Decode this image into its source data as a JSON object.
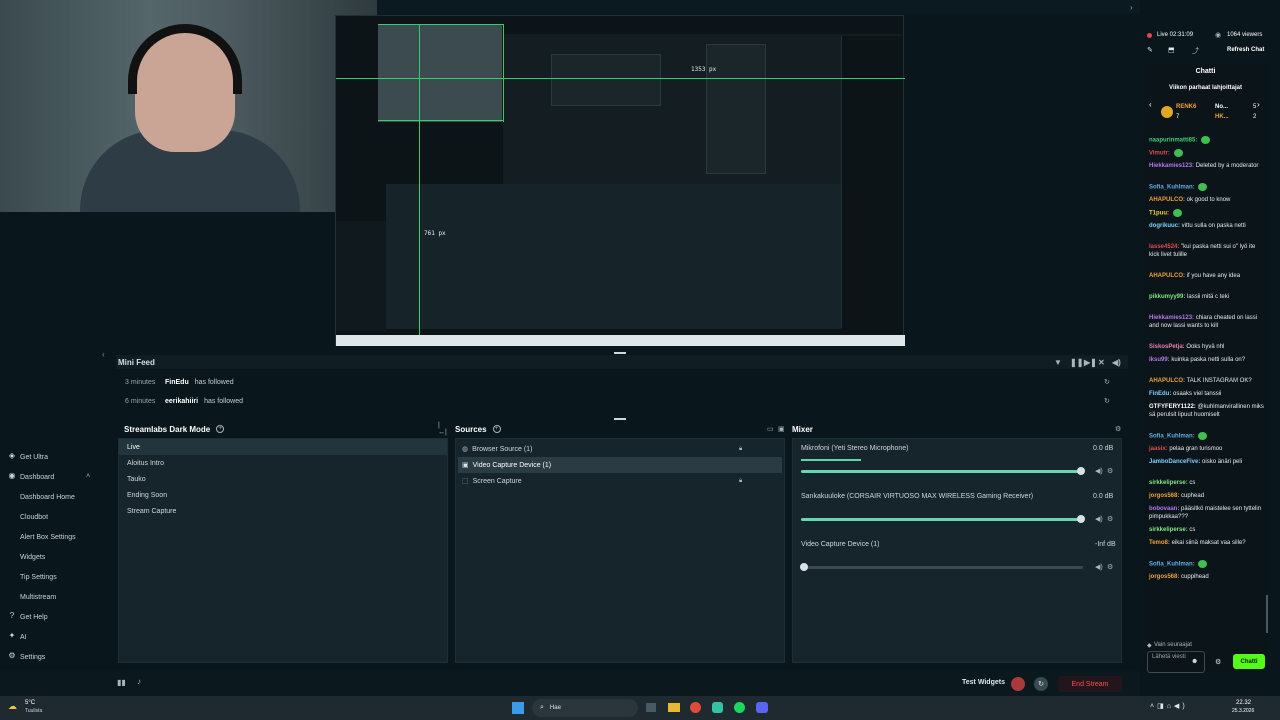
{
  "preview": {
    "measure_w": "1353 px",
    "measure_h": "761 px"
  },
  "minifeed": {
    "title": "Mini Feed",
    "rows": [
      {
        "time": "3 minutes",
        "user": "FinEdu",
        "action": "has followed"
      },
      {
        "time": "6 minutes",
        "user": "eerikahiiri",
        "action": "has followed"
      }
    ]
  },
  "scenes": {
    "title": "Streamlabs Dark Mode",
    "items": [
      "Live",
      "Aloitus Intro",
      "Tauko",
      "Ending Soon",
      "Stream Capture"
    ]
  },
  "sources": {
    "title": "Sources",
    "items": [
      "Browser Source (1)",
      "Video Capture Device (1)",
      "Screen Capture"
    ]
  },
  "mixer": {
    "title": "Mixer",
    "channels": [
      {
        "name": "Mikrofoni (Yeti Stereo Microphone)",
        "db": "0.0 dB",
        "level": 1.0
      },
      {
        "name": "Sankakuuloke (CORSAIR VIRTUOSO MAX WIRELESS Gaming Receiver)",
        "db": "0.0 dB",
        "level": 1.0
      },
      {
        "name": "Video Capture Device (1)",
        "db": "-Inf dB",
        "level": 0.0
      }
    ]
  },
  "sidebar": {
    "get_ultra": "Get Ultra",
    "dashboard": "Dashboard",
    "dashboard_items": [
      "Dashboard Home",
      "Cloudbot",
      "Alert Box Settings",
      "Widgets",
      "Tip Settings",
      "Multistream"
    ],
    "get_help": "Get Help",
    "ai": "AI",
    "settings": "Settings",
    "user": "kuhlmanvirallinen"
  },
  "stream": {
    "live_time": "Live 02:31:09",
    "viewers": "1064 viewers",
    "refresh": "Refresh Chat"
  },
  "chat": {
    "title": "Chatti",
    "top_gifters": "Viikon parhaat lahjoittajat",
    "gifters": [
      "RENK6",
      "No...",
      "HK..."
    ],
    "gifter_counts": [
      "7",
      "5",
      "2"
    ],
    "messages": [
      {
        "name": "naapurinmatti85:",
        "text": "",
        "color": "#3fd07a"
      },
      {
        "name": "Vimutr:",
        "text": "",
        "color": "#e04b4b"
      },
      {
        "name": "Hiekkamies123:",
        "text": "Deleted by a moderator",
        "color": "#b777e8"
      },
      {
        "name": "Sofia_Kuhlman:",
        "text": "",
        "color": "#5fb0e8"
      },
      {
        "name": "AHAPULCO:",
        "text": "ok good to know",
        "color": "#f0a23a"
      },
      {
        "name": "T1puu:",
        "text": "",
        "color": "#f0d23a"
      },
      {
        "name": "dogrikuuc:",
        "text": "vittu sulla on paska netti",
        "color": "#7fcfff"
      },
      {
        "name": "lasse4524:",
        "text": "\"kui paska netti sui o\" lyö ite kick livet tulille",
        "color": "#e04b4b"
      },
      {
        "name": "AHAPULCO:",
        "text": "if you have any idea",
        "color": "#f0a23a"
      },
      {
        "name": "pikkumyy99:",
        "text": "lassii mitä c teki",
        "color": "#7fe87f"
      },
      {
        "name": "Hiekkamies123:",
        "text": "chiara cheated on lassi and now lassi wants to kill",
        "color": "#b777e8"
      },
      {
        "name": "SiskosPetja:",
        "text": "Ooks hyvä nhl",
        "color": "#e87fb0"
      },
      {
        "name": "Iksu99:",
        "text": "kuinka paska netti sulla on?",
        "color": "#b777e8"
      },
      {
        "name": "AHAPULCO:",
        "text": "TALK INSTAGRAM OK?",
        "color": "#f0a23a"
      },
      {
        "name": "FinEdu:",
        "text": "osaaks viel tanssii",
        "color": "#7fcfff"
      },
      {
        "name": "GTFYFERY1122:",
        "text": "@kuhlmanvirallinen miks sä perulsit lipuut huomiselt",
        "color": "#ffffff"
      },
      {
        "name": "Sofia_Kuhlman:",
        "text": "",
        "color": "#5fb0e8"
      },
      {
        "name": "jaasix:",
        "text": "pelaa gran turismoo",
        "color": "#e04b4b"
      },
      {
        "name": "JamboDanceFive:",
        "text": "oisko änäri peli",
        "color": "#7fcfff"
      },
      {
        "name": "sirkkeliperse:",
        "text": "cs",
        "color": "#7fe87f"
      },
      {
        "name": "jorgos568:",
        "text": "cuphead",
        "color": "#f0a23a"
      },
      {
        "name": "bobovaan:",
        "text": "pääsitkö maistelee sen tyttelin pimpukkaa???",
        "color": "#b777e8"
      },
      {
        "name": "sirkkeliperse:",
        "text": "cs",
        "color": "#7fe87f"
      },
      {
        "name": "Temo8:",
        "text": "eikai siinä maksat vaa sille?",
        "color": "#f0a23a"
      },
      {
        "name": "Sofia_Kuhlman:",
        "text": "",
        "color": "#5fb0e8"
      },
      {
        "name": "jorgos568:",
        "text": "cuppihead",
        "color": "#f0a23a"
      }
    ],
    "followers_only": "Vain seuraajat",
    "input_placeholder": "Lähetä viesti",
    "send": "Chatti"
  },
  "bottom": {
    "test_widgets": "Test Widgets",
    "end_stream": "End Stream"
  },
  "taskbar": {
    "weather": "5°C",
    "weather_sub": "Tuulista",
    "search": "Hae",
    "time": "22.32",
    "date": "25.3.2026"
  }
}
